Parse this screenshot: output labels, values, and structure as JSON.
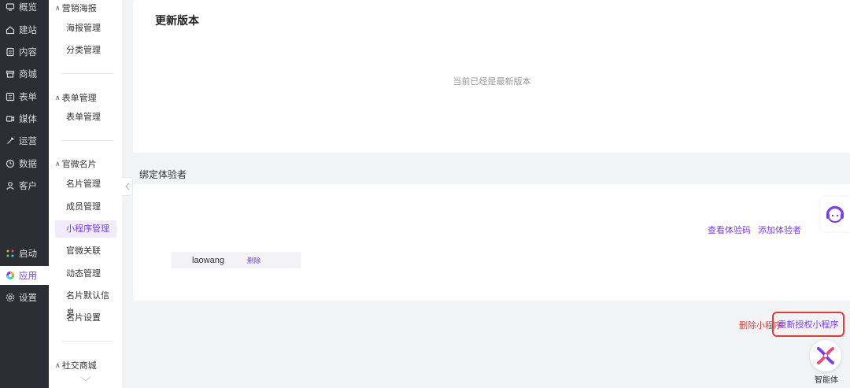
{
  "nav": {
    "items": [
      {
        "label": "概览",
        "icon": "overview-icon"
      },
      {
        "label": "建站",
        "icon": "home-icon"
      },
      {
        "label": "内容",
        "icon": "document-icon"
      },
      {
        "label": "商城",
        "icon": "shop-icon"
      },
      {
        "label": "表单",
        "icon": "form-icon"
      },
      {
        "label": "媒体",
        "icon": "video-icon"
      },
      {
        "label": "运营",
        "icon": "operate-icon"
      },
      {
        "label": "数据",
        "icon": "data-icon"
      },
      {
        "label": "客户",
        "icon": "user-icon"
      }
    ],
    "bottom": [
      {
        "label": "启动",
        "icon": "launch-icon"
      },
      {
        "label": "应用",
        "icon": "apps-icon"
      },
      {
        "label": "设置",
        "icon": "gear-icon"
      }
    ],
    "active_color": "#7b3fe4"
  },
  "sidebar": {
    "groups": [
      {
        "label": "营销海报",
        "items": [
          "海报管理",
          "分类管理"
        ]
      },
      {
        "label": "表单管理",
        "items": [
          "表单管理"
        ]
      },
      {
        "label": "官微名片",
        "items": [
          "名片管理",
          "成员管理",
          "小程序管理",
          "官微关联",
          "动态管理",
          "名片默认信息",
          "名片设置"
        ]
      },
      {
        "label": "社交商城",
        "items": []
      }
    ]
  },
  "main": {
    "update_title": "更新版本",
    "latest_text": "当前已经是最新版本",
    "testers_title": "绑定体验者",
    "view_code": "查看体验码",
    "add_tester": "添加体验者",
    "tester_name": "laowang",
    "delete_label": "删除",
    "delete_mini": "删除小程序",
    "reauth": "重新授权小程序",
    "agent_label": "智能体"
  }
}
